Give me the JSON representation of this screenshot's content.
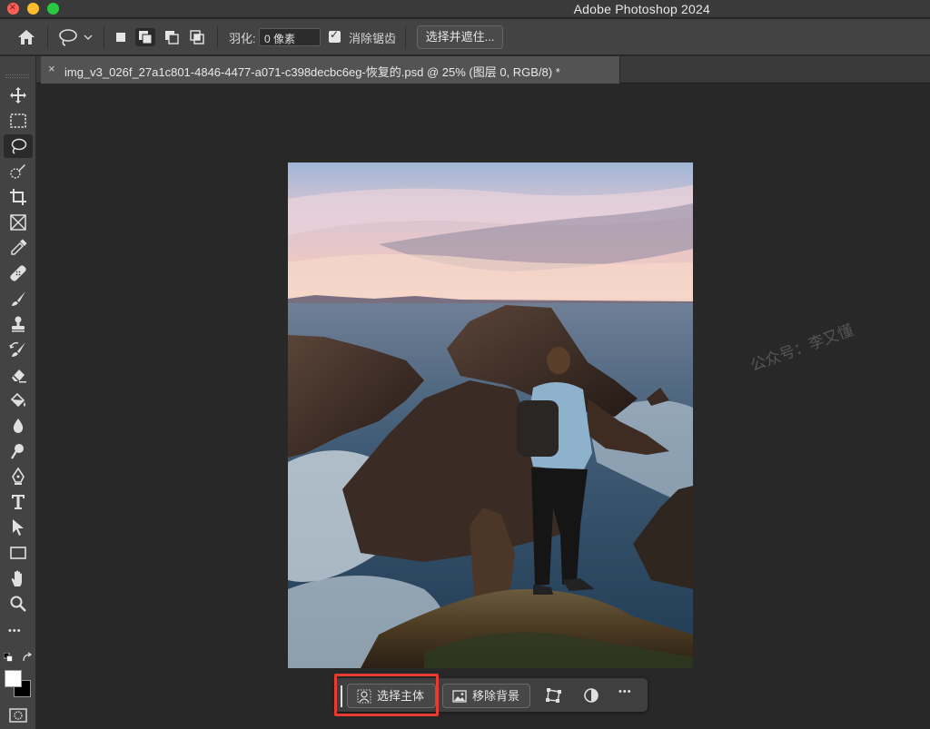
{
  "window": {
    "title": "Adobe Photoshop 2024"
  },
  "options_bar": {
    "feather_label": "羽化:",
    "feather_value": "0 像素",
    "anti_alias_label": "消除锯齿",
    "anti_alias_checked": true,
    "select_and_mask_label": "选择并遮住..."
  },
  "tabs": {
    "collapse_glyph": "››",
    "close_glyph": "×",
    "doc_title": "img_v3_026f_27a1c801-4846-4477-a071-c398decbc6eg-恢复的.psd @ 25% (图层 0, RGB/8) *"
  },
  "toolbar": {
    "tools": [
      "move-tool-icon",
      "marquee-tool-icon",
      "lasso-tool-icon",
      "quick-selection-tool-icon",
      "crop-tool-icon",
      "frame-tool-icon",
      "eyedropper-tool-icon",
      "healing-brush-icon",
      "brush-tool-icon",
      "clone-stamp-icon",
      "history-brush-icon",
      "eraser-tool-icon",
      "paint-bucket-icon",
      "blur-tool-icon",
      "dodge-tool-icon",
      "pen-tool-icon",
      "type-tool-icon",
      "path-selection-icon",
      "rectangle-tool-icon",
      "hand-tool-icon",
      "zoom-tool-icon",
      "more-tools-icon"
    ],
    "active_tool": "lasso-tool-icon",
    "more_glyph": "•••",
    "foreground_color": "#ffffff",
    "background_color": "#000000"
  },
  "watermark": "公众号：李又懂",
  "context_bar": {
    "select_subject_label": "选择主体",
    "remove_background_label": "移除背景",
    "more_glyph": "•••"
  },
  "colors": {
    "highlight": "#e63b2e",
    "panel": "#434343",
    "canvas_bg": "#282828"
  }
}
